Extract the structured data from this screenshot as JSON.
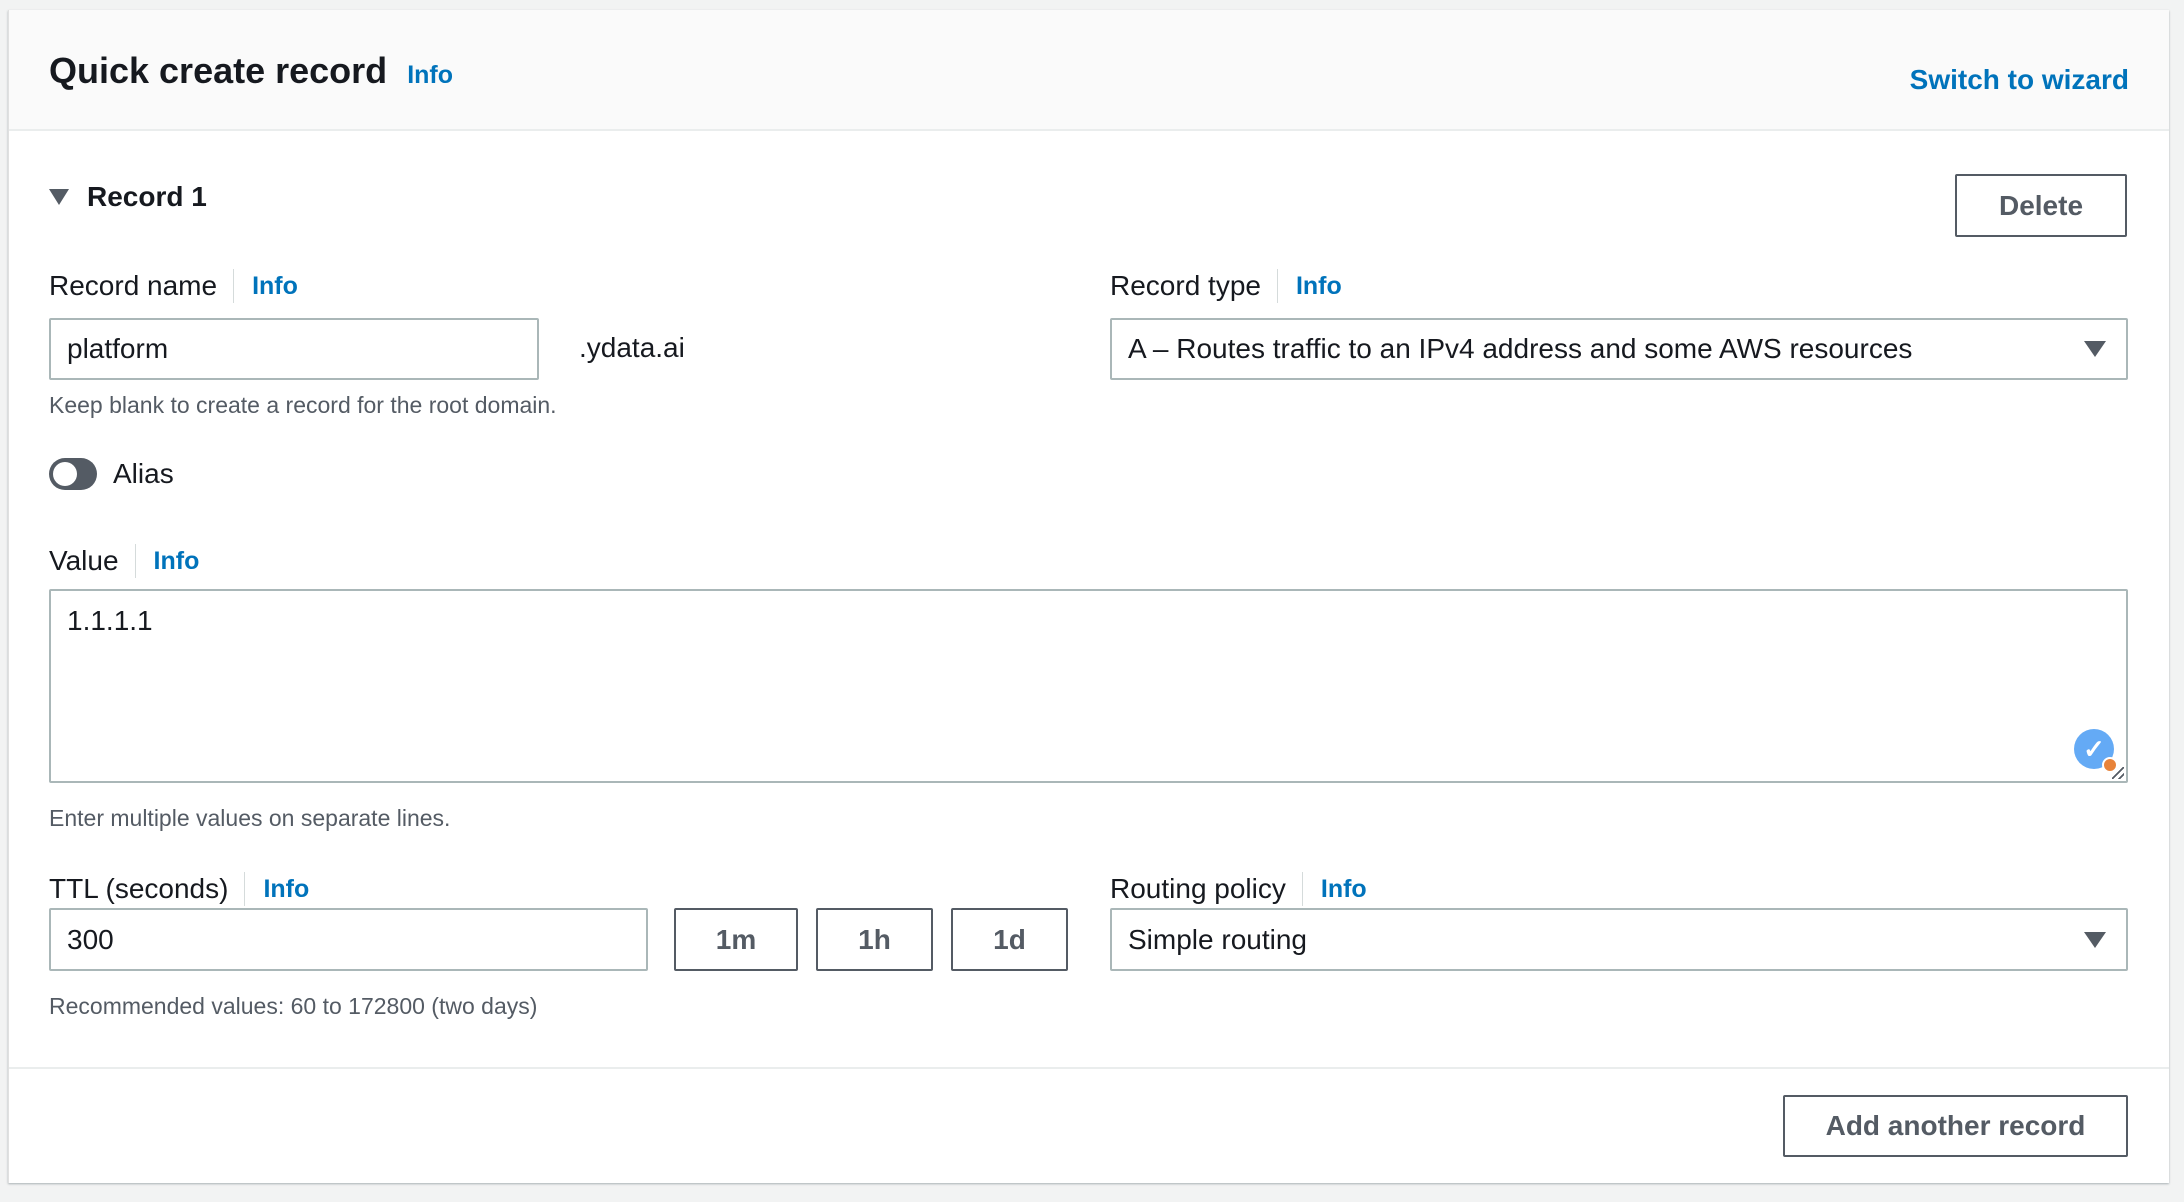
{
  "header": {
    "title": "Quick create record",
    "info": "Info",
    "switch_link": "Switch to wizard"
  },
  "record": {
    "title": "Record 1",
    "delete": "Delete",
    "name_label": "Record name",
    "name_info": "Info",
    "name_value": "platform",
    "domain_suffix": ".ydata.ai",
    "name_help": "Keep blank to create a record for the root domain.",
    "type_label": "Record type",
    "type_info": "Info",
    "type_value": "A – Routes traffic to an IPv4 address and some AWS resources",
    "alias_label": "Alias",
    "alias_on": false,
    "value_label": "Value",
    "value_info": "Info",
    "value_text": "1.1.1.1",
    "value_help": "Enter multiple values on separate lines.",
    "ttl_label": "TTL (seconds)",
    "ttl_info": "Info",
    "ttl_value": "300",
    "ttl_buttons": [
      "1m",
      "1h",
      "1d"
    ],
    "ttl_help": "Recommended values: 60 to 172800 (two days)",
    "routing_label": "Routing policy",
    "routing_info": "Info",
    "routing_value": "Simple routing"
  },
  "footer": {
    "add_another": "Add another record"
  },
  "colors": {
    "link": "#0073bb",
    "check_badge": "#64aaf5",
    "badge_dot": "#e8833a"
  }
}
